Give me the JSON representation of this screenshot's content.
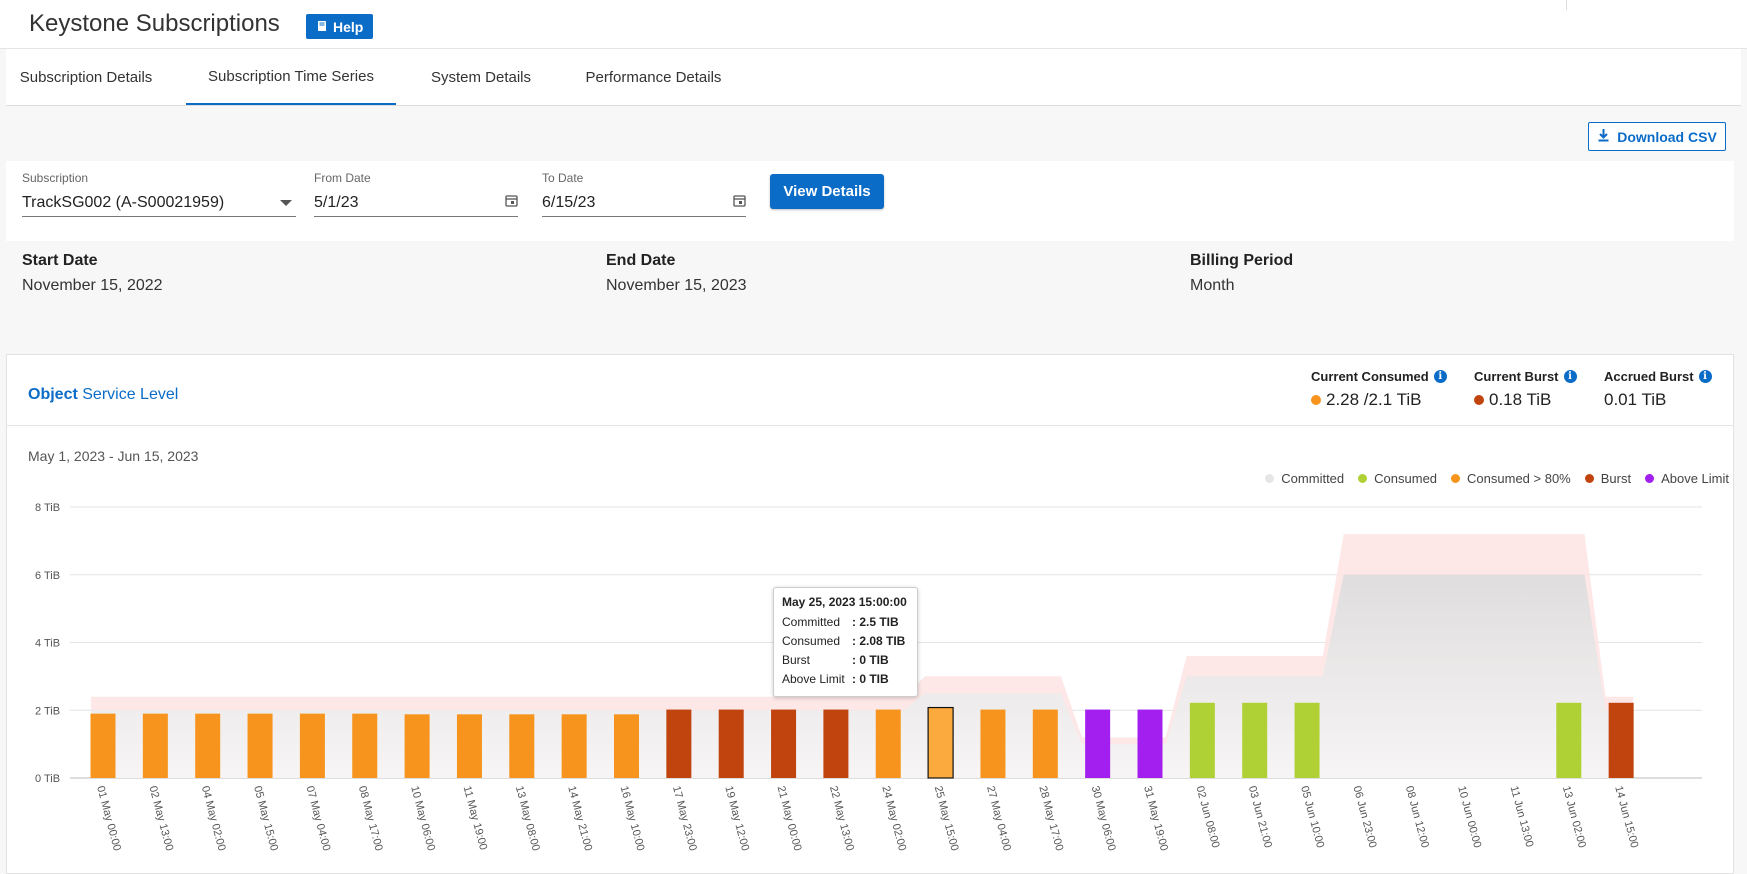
{
  "app": {
    "title": "Keystone Subscriptions",
    "help_label": "Help"
  },
  "tabs": [
    {
      "label": "Subscription Details"
    },
    {
      "label": "Subscription Time Series"
    },
    {
      "label": "System Details"
    },
    {
      "label": "Performance Details"
    }
  ],
  "active_tab": "Subscription Time Series",
  "toolbar": {
    "download_label": "Download CSV"
  },
  "filters": {
    "subscription": {
      "label": "Subscription",
      "value": "TrackSG002 (A-S00021959)"
    },
    "from_date": {
      "label": "From Date",
      "value": "5/1/23"
    },
    "to_date": {
      "label": "To Date",
      "value": "6/15/23"
    },
    "view_label": "View Details"
  },
  "info": {
    "start_date": {
      "label": "Start Date",
      "value": "November 15, 2022"
    },
    "end_date": {
      "label": "End Date",
      "value": "November 15, 2023"
    },
    "billing_period": {
      "label": "Billing Period",
      "value": "Month"
    }
  },
  "card": {
    "service_bold": "Object",
    "service_rest": "Service Level",
    "current_consumed": {
      "label": "Current Consumed",
      "value": "2.28 /2.1 TiB"
    },
    "current_burst": {
      "label": "Current Burst",
      "value": "0.18 TiB"
    },
    "accrued_burst": {
      "label": "Accrued Burst",
      "value": "0.01 TiB"
    },
    "date_range": "May 1, 2023 - Jun 15, 2023"
  },
  "legend": [
    {
      "label": "Committed",
      "color": "#e6e6e6"
    },
    {
      "label": "Consumed",
      "color": "#b0d135"
    },
    {
      "label": "Consumed > 80%",
      "color": "#f7941d"
    },
    {
      "label": "Burst",
      "color": "#c1440e"
    },
    {
      "label": "Above Limit",
      "color": "#a31ff0"
    }
  ],
  "tooltip": {
    "title": "May 25, 2023 15:00:00",
    "rows": [
      {
        "key": "Committed",
        "value": ": 2.5 TIB"
      },
      {
        "key": "Consumed",
        "value": ": 2.08 TIB"
      },
      {
        "key": "Burst",
        "value": ": 0 TIB"
      },
      {
        "key": "Above Limit",
        "value": ": 0 TIB"
      }
    ]
  },
  "chart_data": {
    "type": "bar",
    "ylabel_unit": "TiB",
    "yticks": [
      "0 TiB",
      "2 TiB",
      "4 TiB",
      "6 TiB",
      "8 TiB"
    ],
    "ylim": [
      0,
      8
    ],
    "categories": [
      "01 May 00:00",
      "02 May 13:00",
      "04 May 02:00",
      "05 May 15:00",
      "07 May 04:00",
      "08 May 17:00",
      "10 May 06:00",
      "11 May 19:00",
      "13 May 08:00",
      "14 May 21:00",
      "16 May 10:00",
      "17 May 23:00",
      "19 May 12:00",
      "21 May 00:00",
      "22 May 13:00",
      "24 May 02:00",
      "25 May 15:00",
      "27 May 04:00",
      "28 May 17:00",
      "30 May 06:00",
      "31 May 19:00",
      "02 Jun 08:00",
      "03 Jun 21:00",
      "05 Jun 10:00",
      "06 Jun 23:00",
      "08 Jun 12:00",
      "10 Jun 00:00",
      "11 Jun 13:00",
      "13 Jun 02:00",
      "14 Jun 15:00"
    ],
    "values": [
      1.9,
      1.9,
      1.9,
      1.9,
      1.9,
      1.9,
      1.88,
      1.88,
      1.88,
      1.88,
      1.88,
      2.02,
      2.02,
      2.02,
      2.02,
      2.02,
      2.08,
      2.02,
      2.02,
      2.02,
      2.02,
      2.22,
      2.22,
      2.22,
      0,
      0,
      0,
      0,
      2.22,
      2.22
    ],
    "bar_status": [
      "consumed80",
      "consumed80",
      "consumed80",
      "consumed80",
      "consumed80",
      "consumed80",
      "consumed80",
      "consumed80",
      "consumed80",
      "consumed80",
      "consumed80",
      "burst",
      "burst",
      "burst",
      "burst",
      "consumed80",
      "consumed80",
      "consumed80",
      "consumed80",
      "above",
      "above",
      "consumed",
      "consumed",
      "consumed",
      "none",
      "none",
      "none",
      "none",
      "consumed",
      "burst"
    ],
    "committed": [
      2.0,
      2.0,
      2.0,
      2.0,
      2.0,
      2.0,
      2.0,
      2.0,
      2.0,
      2.0,
      2.0,
      2.0,
      2.0,
      2.0,
      2.0,
      2.0,
      2.5,
      2.5,
      2.5,
      1.0,
      1.0,
      3.0,
      3.0,
      3.0,
      6.0,
      6.0,
      6.0,
      6.0,
      6.0,
      2.0
    ],
    "limit": [
      2.4,
      2.4,
      2.4,
      2.4,
      2.4,
      2.4,
      2.4,
      2.4,
      2.4,
      2.4,
      2.4,
      2.4,
      2.4,
      2.4,
      2.4,
      2.4,
      3.0,
      3.0,
      3.0,
      1.2,
      1.2,
      3.6,
      3.6,
      3.6,
      7.2,
      7.2,
      7.2,
      7.2,
      7.2,
      2.4
    ],
    "highlighted_index": 16
  }
}
